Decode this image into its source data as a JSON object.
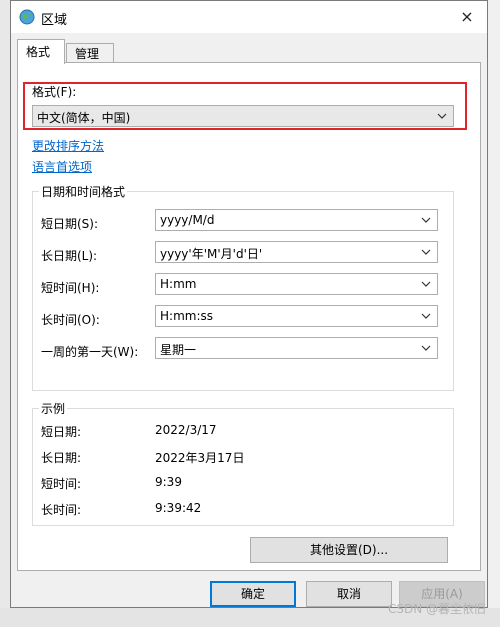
{
  "dialog": {
    "title": "区域",
    "close_label": "×",
    "tabs": [
      {
        "label": "格式",
        "active": true
      },
      {
        "label": "管理",
        "active": false
      }
    ],
    "format": {
      "label": "格式(F):",
      "value": "中文(简体，中国)"
    },
    "links": {
      "change_sort": "更改排序方法",
      "language_pref": "语言首选项"
    },
    "datetime_group": {
      "title": "日期和时间格式",
      "rows": [
        {
          "label": "短日期(S):",
          "value": "yyyy/M/d"
        },
        {
          "label": "长日期(L):",
          "value": "yyyy'年'M'月'd'日'"
        },
        {
          "label": "短时间(H):",
          "value": "H:mm"
        },
        {
          "label": "长时间(O):",
          "value": "H:mm:ss"
        },
        {
          "label": "一周的第一天(W):",
          "value": "星期一"
        }
      ]
    },
    "examples_group": {
      "title": "示例",
      "rows": [
        {
          "label": "短日期:",
          "value": "2022/3/17"
        },
        {
          "label": "长日期:",
          "value": "2022年3月17日"
        },
        {
          "label": "短时间:",
          "value": "9:39"
        },
        {
          "label": "长时间:",
          "value": "9:39:42"
        }
      ]
    },
    "buttons": {
      "other_settings": "其他设置(D)...",
      "ok": "确定",
      "cancel": "取消",
      "apply": "应用(A)"
    }
  },
  "watermark": "CSDN @暮尘依旧",
  "colors": {
    "highlight": "#e0242b",
    "link": "#0066cc",
    "primary_border": "#0078d7"
  }
}
